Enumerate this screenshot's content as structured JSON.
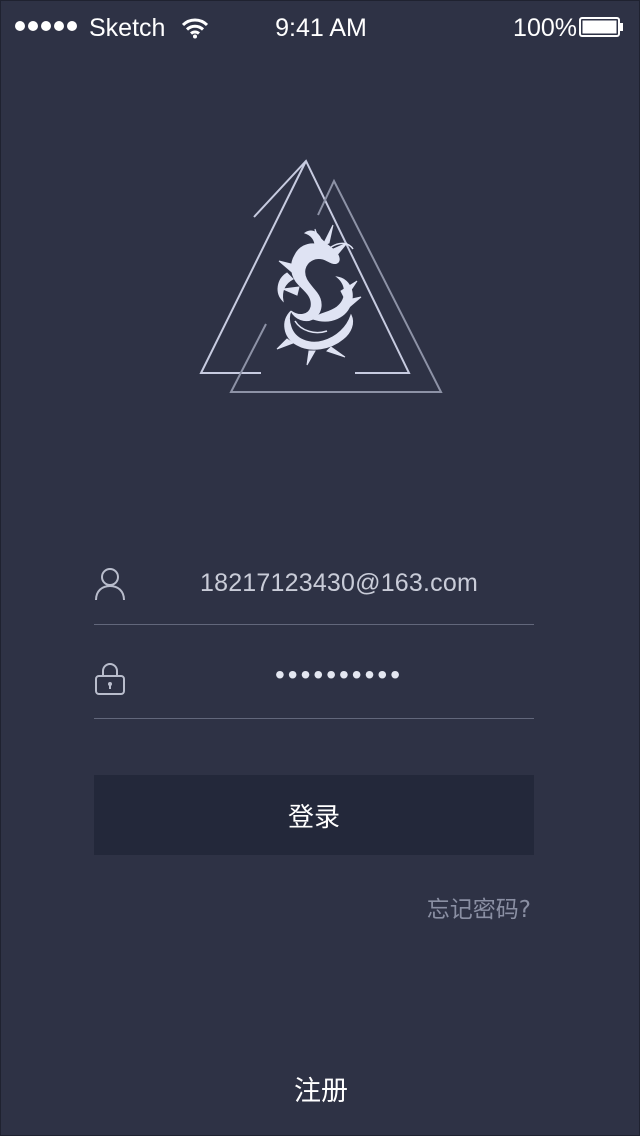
{
  "status_bar": {
    "carrier": "Sketch",
    "time": "9:41 AM",
    "battery": "100%",
    "signal_icon": "signal-dots-icon",
    "wifi_icon": "wifi-icon",
    "battery_icon": "battery-icon"
  },
  "logo": {
    "icon": "dragon-triangle-logo"
  },
  "form": {
    "account": {
      "icon": "user-icon",
      "value": "18217123430@163.com"
    },
    "password": {
      "icon": "lock-icon",
      "value": "••••••••••"
    },
    "login_label": "登录",
    "forgot_label": "忘记密码?"
  },
  "footer": {
    "register_label": "注册"
  },
  "colors": {
    "background": "#2e3245",
    "button": "#23283a",
    "divider": "#62677b",
    "muted_text": "#8a8fa3"
  }
}
